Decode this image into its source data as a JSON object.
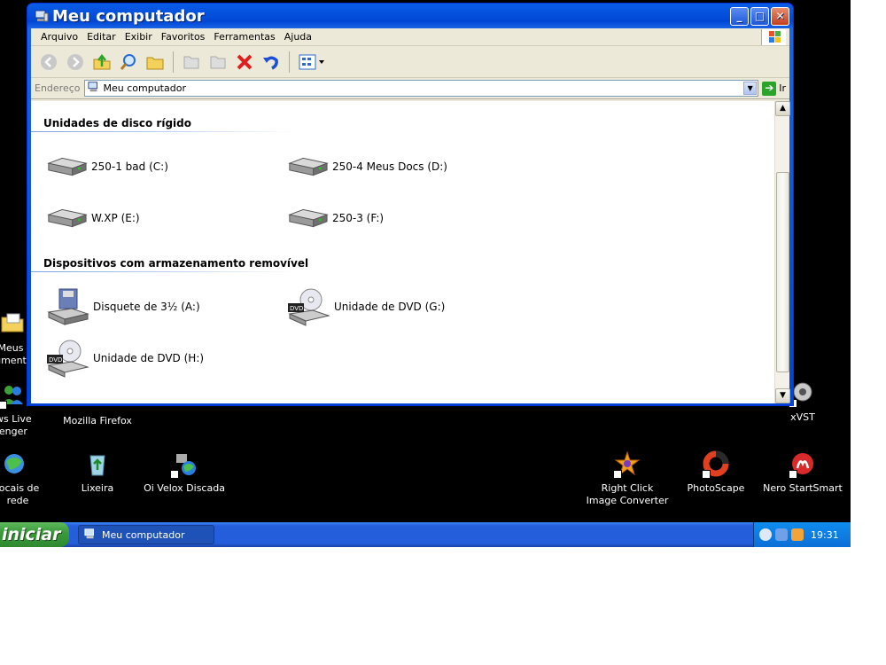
{
  "window": {
    "title": "Meu computador",
    "menu": [
      "Arquivo",
      "Editar",
      "Exibir",
      "Favoritos",
      "Ferramentas",
      "Ajuda"
    ],
    "address_label": "Endereço",
    "address_value": "Meu computador",
    "go_label": "Ir"
  },
  "groups": {
    "hard_disks": {
      "title": "Unidades de disco rígido",
      "items": [
        "250-1 bad (C:)",
        "250-4 Meus Docs (D:)",
        "W.XP (E:)",
        "250-3 (F:)"
      ]
    },
    "removable": {
      "title": "Dispositivos com armazenamento removível",
      "items": [
        "Disquete de 3½ (A:)",
        "Unidade de DVD (G:)",
        "Unidade de DVD (H:)"
      ]
    }
  },
  "desktop": {
    "meus_documentos": "Meus\nument",
    "live_messenger": "ows Live\nsenger",
    "firefox": "Mozilla Firefox",
    "xvst": "xVST",
    "locais_rede": "locais de\nrede",
    "lixeira": "Lixeira",
    "oi_velox": "Oi Velox Discada",
    "right_click": "Right Click\nImage Converter",
    "photoscape": "PhotoScape",
    "nero": "Nero StartSmart"
  },
  "taskbar": {
    "start_label": "iniciar",
    "task_label": "Meu computador",
    "clock": "19:31"
  },
  "colors": {
    "titlebar_blue": "#0046d5",
    "start_green": "#3c9b3c",
    "group_rule": "#7aa0e0"
  }
}
